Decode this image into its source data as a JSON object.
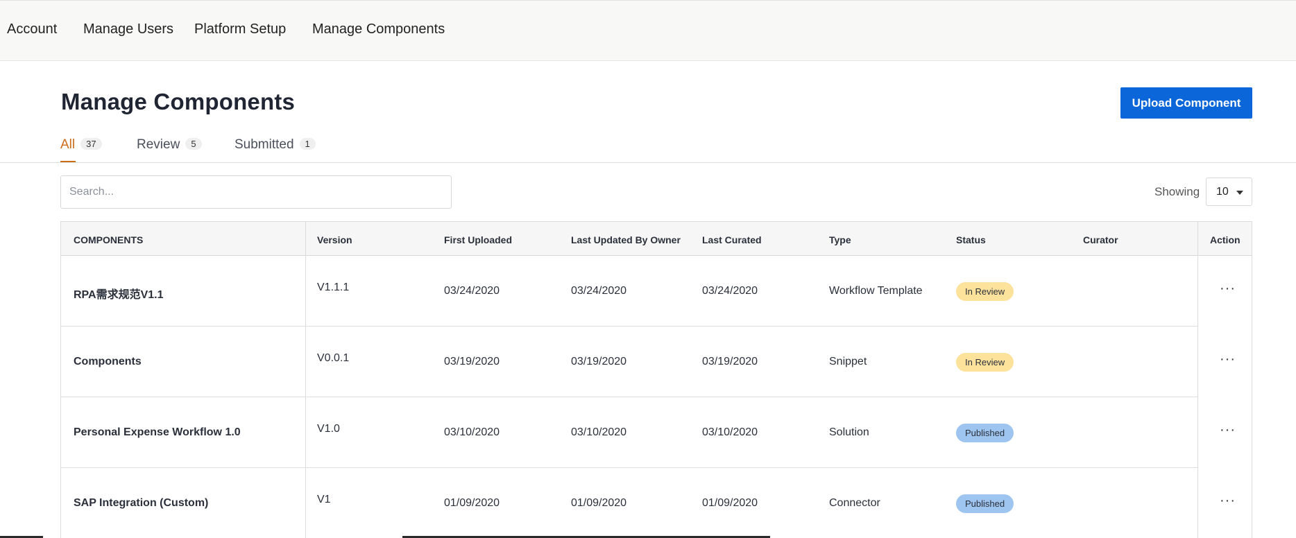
{
  "nav": {
    "items": [
      "Account",
      "Manage Users",
      "Platform Setup",
      "Manage Components"
    ]
  },
  "page": {
    "title": "Manage Components",
    "upload_label": "Upload Component"
  },
  "tabs": [
    {
      "label": "All",
      "count": "37"
    },
    {
      "label": "Review",
      "count": "5"
    },
    {
      "label": "Submitted",
      "count": "1"
    }
  ],
  "search": {
    "placeholder": "Search...",
    "value": ""
  },
  "pagination": {
    "showing_label": "Showing",
    "page_size": "10"
  },
  "table": {
    "columns": [
      "COMPONENTS",
      "Version",
      "First Uploaded",
      "Last Updated By Owner",
      "Last Curated",
      "Type",
      "Status",
      "Curator",
      "Action"
    ],
    "rows": [
      {
        "name": "RPA需求规范V1.1",
        "version": "V1.1.1",
        "first_uploaded": "03/24/2020",
        "last_updated": "03/24/2020",
        "last_curated": "03/24/2020",
        "type": "Workflow Template",
        "status": "In Review",
        "curator": ""
      },
      {
        "name": "Components",
        "version": "V0.0.1",
        "first_uploaded": "03/19/2020",
        "last_updated": "03/19/2020",
        "last_curated": "03/19/2020",
        "type": "Snippet",
        "status": "In Review",
        "curator": ""
      },
      {
        "name": "Personal Expense Workflow 1.0",
        "version": "V1.0",
        "first_uploaded": "03/10/2020",
        "last_updated": "03/10/2020",
        "last_curated": "03/10/2020",
        "type": "Solution",
        "status": "Published",
        "curator": ""
      },
      {
        "name": "SAP Integration (Custom)",
        "version": "V1",
        "first_uploaded": "01/09/2020",
        "last_updated": "01/09/2020",
        "last_curated": "01/09/2020",
        "type": "Connector",
        "status": "Published",
        "curator": ""
      }
    ],
    "action_glyph": "···"
  },
  "colors": {
    "accent": "#0a66d9",
    "active_tab": "#cc6d18",
    "status_review": "#fde29c",
    "status_published": "#9ec5f0"
  },
  "icons": {
    "row_action": "more-horizontal-icon",
    "page_size": "chevron-down-icon"
  }
}
